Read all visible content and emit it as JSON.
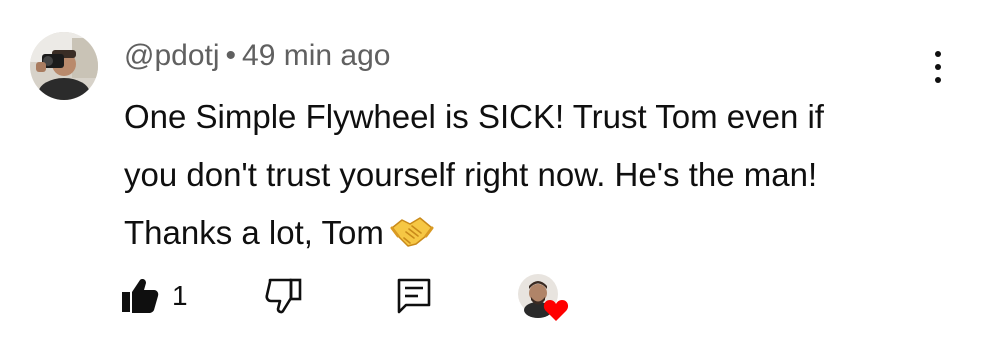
{
  "comment": {
    "username": "@pdotj",
    "separator": "•",
    "time_ago": "49 min ago",
    "text_lines": [
      "One Simple Flywheel is SICK! Trust Tom even if",
      "you don't trust yourself right now. He's the man!",
      "Thanks a lot, Tom"
    ],
    "emoji_icon": "handshake-icon"
  },
  "actions": {
    "like_count": "1",
    "like_icon": "thumbs-up-filled-icon",
    "dislike_icon": "thumbs-down-outline-icon",
    "reply_icon": "reply-comment-icon",
    "creator_heart_icon": "creator-heart-icon",
    "heart_color": "#ff0000"
  },
  "menu": {
    "icon": "more-vertical-icon"
  }
}
